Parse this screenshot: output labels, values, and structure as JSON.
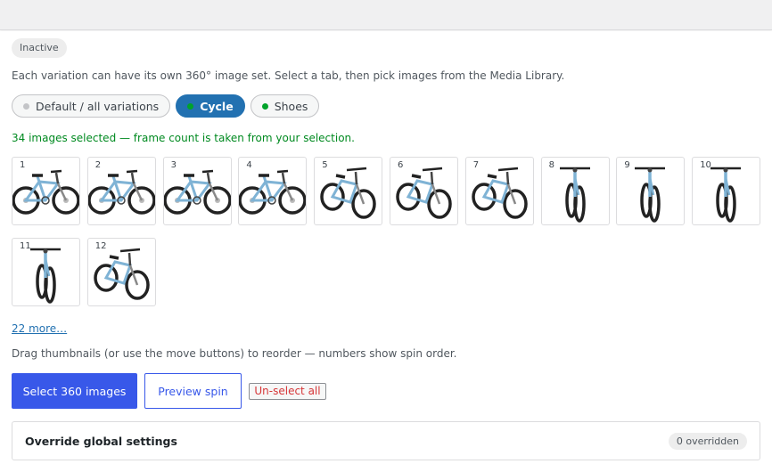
{
  "status": {
    "label": "Inactive"
  },
  "intro": "Each variation can have its own 360° image set. Select a tab, then pick images from the Media Library.",
  "tabs": [
    {
      "label": "Default / all variations",
      "dot_color": "#c3c4c7",
      "active": false
    },
    {
      "label": "Cycle",
      "dot_color": "#00a32a",
      "active": true
    },
    {
      "label": "Shoes",
      "dot_color": "#00a32a",
      "active": false
    }
  ],
  "selection": {
    "text": "34 images selected — frame count is taken from your selection.",
    "color": "#008a20"
  },
  "thumbnails": [
    {
      "number": "1",
      "icon": "bicycle-side-view"
    },
    {
      "number": "2",
      "icon": "bicycle-side-view"
    },
    {
      "number": "3",
      "icon": "bicycle-side-view"
    },
    {
      "number": "4",
      "icon": "bicycle-side-view"
    },
    {
      "number": "5",
      "icon": "bicycle-three-quarter-view"
    },
    {
      "number": "6",
      "icon": "bicycle-three-quarter-view"
    },
    {
      "number": "7",
      "icon": "bicycle-three-quarter-view"
    },
    {
      "number": "8",
      "icon": "bicycle-front-view"
    },
    {
      "number": "9",
      "icon": "bicycle-front-view"
    },
    {
      "number": "10",
      "icon": "bicycle-front-view"
    },
    {
      "number": "11",
      "icon": "bicycle-front-view"
    },
    {
      "number": "12",
      "icon": "bicycle-three-quarter-view"
    }
  ],
  "more_link": "22 more…",
  "hint": "Drag thumbnails (or use the move buttons) to reorder — numbers show spin order.",
  "buttons": {
    "select": "Select 360 images",
    "preview": "Preview spin",
    "unselect": "Un-select all"
  },
  "override": {
    "title": "Override global settings",
    "count": "0 overridden"
  },
  "colors": {
    "accent": "#3858e9",
    "tab_active": "#2271b1",
    "danger": "#d63638",
    "bike_frame": "#7fb3d5"
  }
}
